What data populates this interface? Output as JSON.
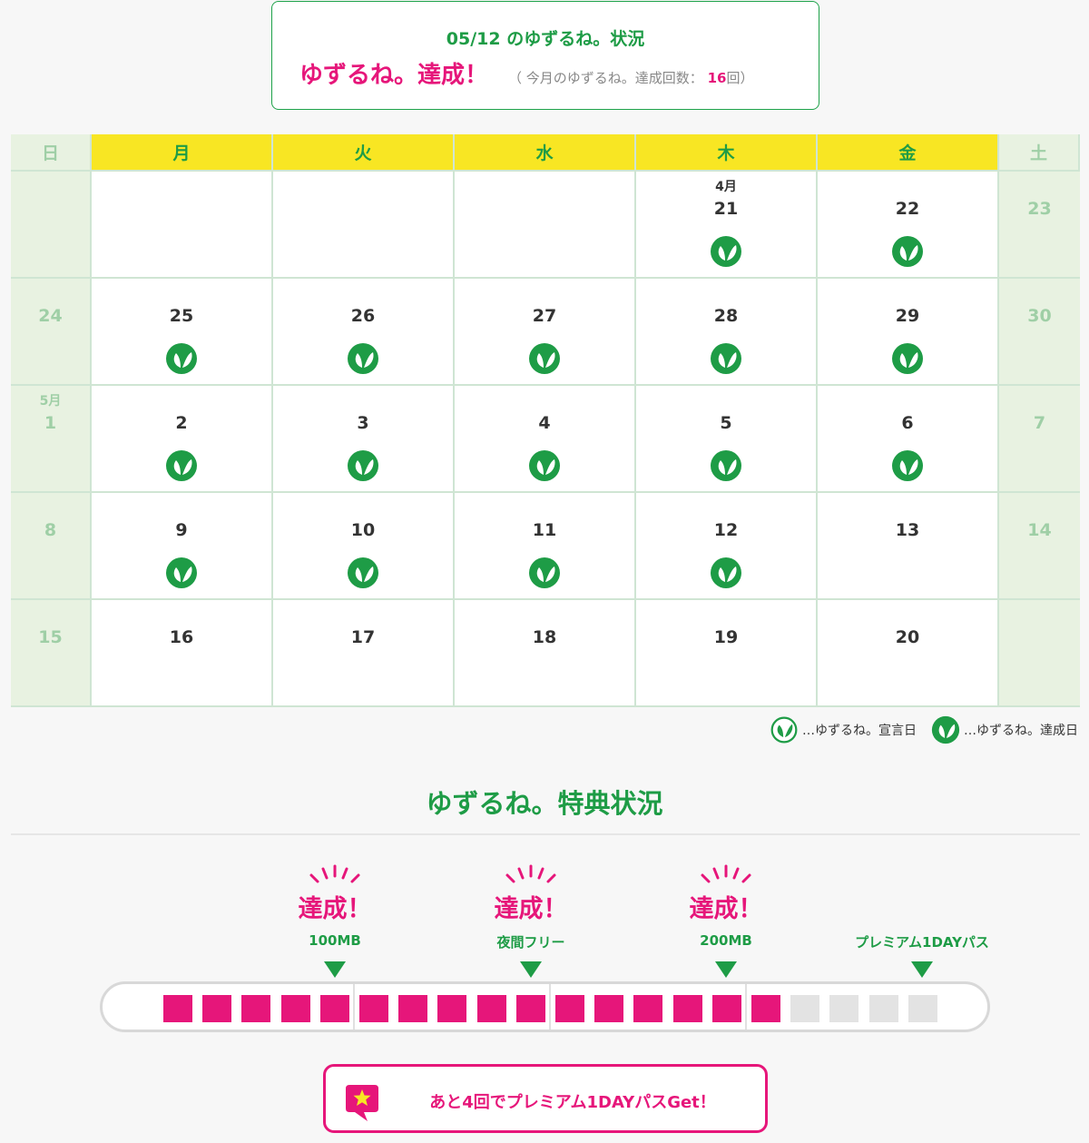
{
  "status": {
    "date_line": "05/12 のゆずるね。状況",
    "main": "ゆずるね。達成！",
    "sub_prefix": "（ 今月のゆずるね。達成回数：",
    "count": "16",
    "sub_suffix": "回）"
  },
  "calendar": {
    "weekdays": [
      "日",
      "月",
      "火",
      "水",
      "木",
      "金",
      "土"
    ],
    "weeks": [
      [
        {
          "day": "",
          "month": "",
          "achieved": false
        },
        {
          "day": "",
          "month": "",
          "achieved": false
        },
        {
          "day": "",
          "month": "",
          "achieved": false
        },
        {
          "day": "",
          "month": "",
          "achieved": false
        },
        {
          "day": "21",
          "month": "4月",
          "achieved": true
        },
        {
          "day": "22",
          "month": "",
          "achieved": true
        },
        {
          "day": "23",
          "month": "",
          "achieved": false
        }
      ],
      [
        {
          "day": "24",
          "month": "",
          "achieved": false
        },
        {
          "day": "25",
          "month": "",
          "achieved": true
        },
        {
          "day": "26",
          "month": "",
          "achieved": true
        },
        {
          "day": "27",
          "month": "",
          "achieved": true
        },
        {
          "day": "28",
          "month": "",
          "achieved": true
        },
        {
          "day": "29",
          "month": "",
          "achieved": true
        },
        {
          "day": "30",
          "month": "",
          "achieved": false
        }
      ],
      [
        {
          "day": "1",
          "month": "5月",
          "achieved": false
        },
        {
          "day": "2",
          "month": "",
          "achieved": true
        },
        {
          "day": "3",
          "month": "",
          "achieved": true
        },
        {
          "day": "4",
          "month": "",
          "achieved": true
        },
        {
          "day": "5",
          "month": "",
          "achieved": true
        },
        {
          "day": "6",
          "month": "",
          "achieved": true
        },
        {
          "day": "7",
          "month": "",
          "achieved": false
        }
      ],
      [
        {
          "day": "8",
          "month": "",
          "achieved": false
        },
        {
          "day": "9",
          "month": "",
          "achieved": true
        },
        {
          "day": "10",
          "month": "",
          "achieved": true
        },
        {
          "day": "11",
          "month": "",
          "achieved": true
        },
        {
          "day": "12",
          "month": "",
          "achieved": true
        },
        {
          "day": "13",
          "month": "",
          "achieved": false
        },
        {
          "day": "14",
          "month": "",
          "achieved": false
        }
      ],
      [
        {
          "day": "15",
          "month": "",
          "achieved": false
        },
        {
          "day": "16",
          "month": "",
          "achieved": false
        },
        {
          "day": "17",
          "month": "",
          "achieved": false
        },
        {
          "day": "18",
          "month": "",
          "achieved": false
        },
        {
          "day": "19",
          "month": "",
          "achieved": false
        },
        {
          "day": "20",
          "month": "",
          "achieved": false
        },
        {
          "day": "",
          "month": "",
          "achieved": false
        }
      ]
    ]
  },
  "legend": {
    "declared": "…ゆずるね。宣言日",
    "achieved": "…ゆずるね。達成日"
  },
  "benefits": {
    "title": "ゆずるね。特典状況",
    "achieved_label": "達成！",
    "milestones": [
      "100MB",
      "夜間フリー",
      "200MB",
      "プレミアム1DAYパス"
    ],
    "milestones_reached": 3,
    "progress_filled": 16,
    "progress_total": 20,
    "cta": "あと4回でプレミアム1DAYパスGet！"
  },
  "colors": {
    "green": "#1e9c46",
    "pink": "#e6167a",
    "yellow": "#f8e623",
    "weekend_bg": "#e8f2e1"
  },
  "icons": [
    "leaf-badge-icon",
    "leaf-outline-icon",
    "star-speech-bubble-icon"
  ]
}
